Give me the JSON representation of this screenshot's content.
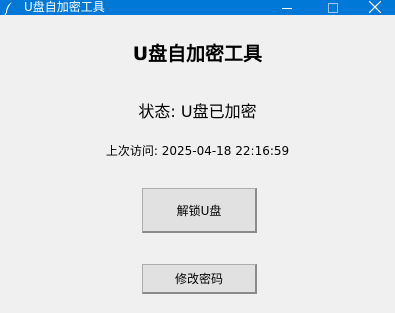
{
  "window": {
    "title": "U盘自加密工具",
    "icon": "feather-icon",
    "controls": {
      "minimize_icon": "minimize-icon",
      "maximize_icon": "maximize-icon",
      "close_icon": "close-icon"
    },
    "titlebar_color": "#0078d7"
  },
  "main": {
    "heading": "U盘自加密工具",
    "status": "状态: U盘已加密",
    "last_visit": "上次访问: 2025-04-18 22:16:59",
    "unlock_button": "解锁U盘",
    "change_password_button": "修改密码"
  }
}
